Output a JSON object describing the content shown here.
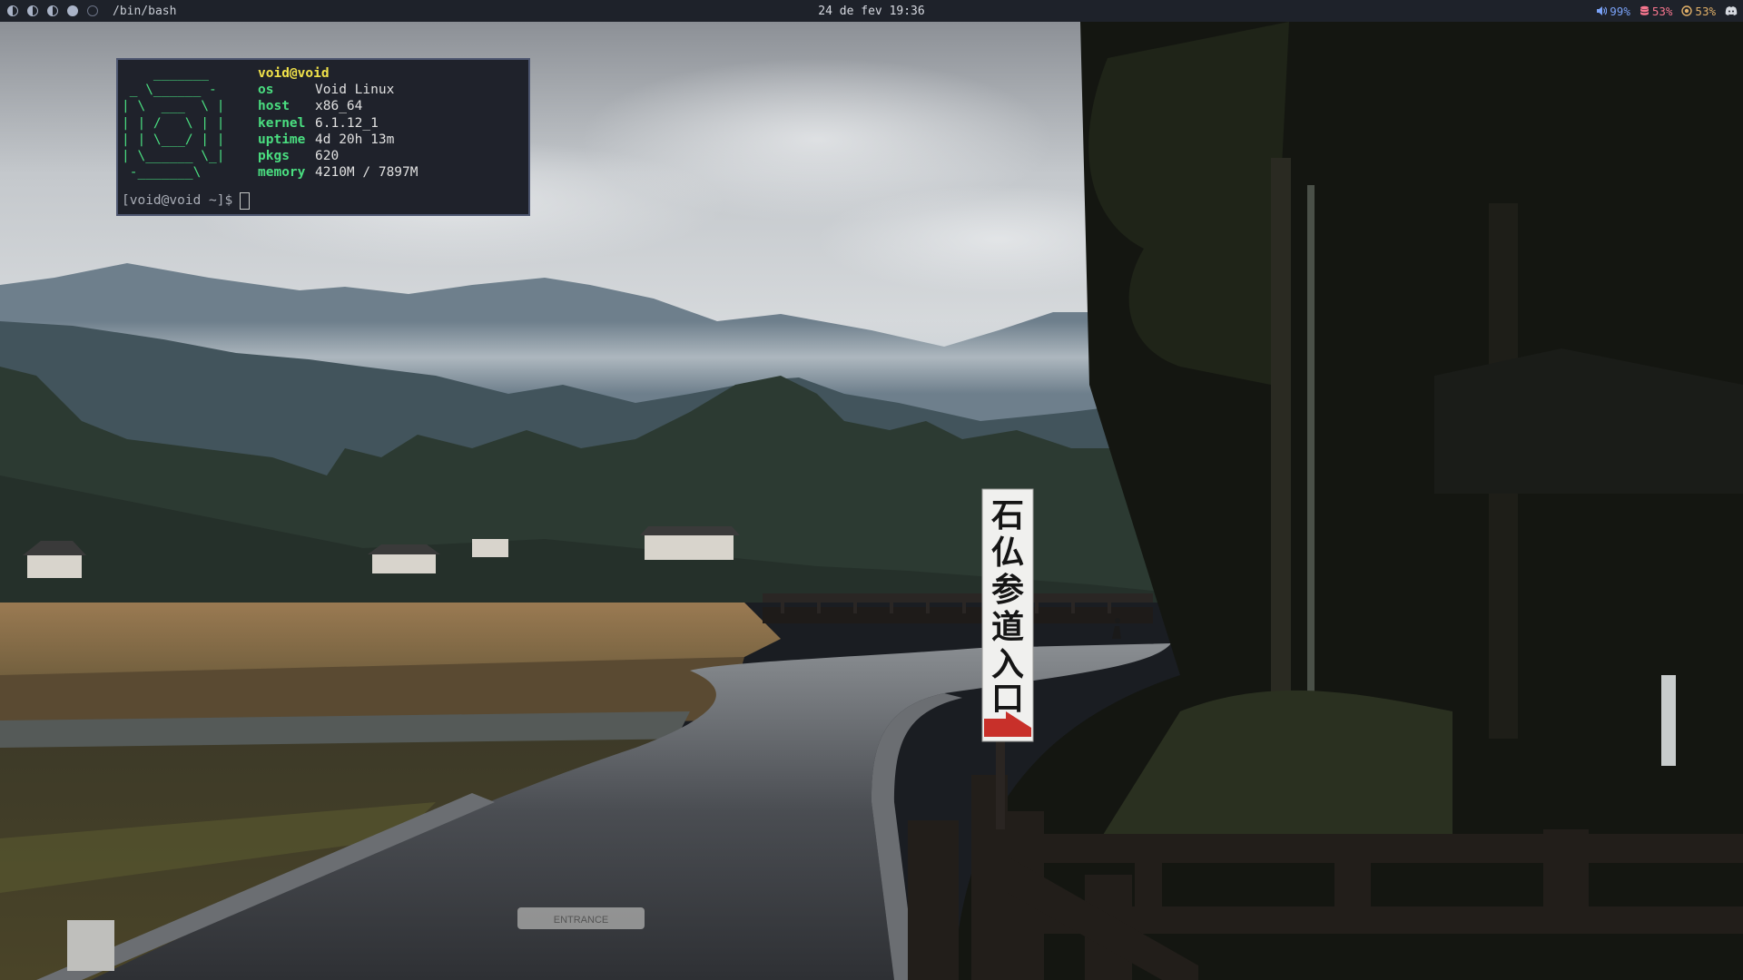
{
  "topbar": {
    "workspaces": [
      "half",
      "half",
      "half",
      "full",
      "empty"
    ],
    "window_title": "/bin/bash",
    "clock": "24 de fev 19:36",
    "status": {
      "volume": "99%",
      "disk": "53%",
      "cpu": "53%",
      "volume_color": "#7aa2f7",
      "disk_color": "#f7768e",
      "cpu_color": "#e0af68"
    }
  },
  "terminal": {
    "ascii_logo": "    _______\n _ \\______ -\n| \\  ___  \\ |\n| | /   \\ | |\n| | \\___/ | |\n| \\______ \\_|\n -_______\\",
    "user_host": "void@void",
    "fields": [
      {
        "key": "os",
        "value": "Void Linux"
      },
      {
        "key": "host",
        "value": "x86_64"
      },
      {
        "key": "kernel",
        "value": "6.1.12_1"
      },
      {
        "key": "uptime",
        "value": "4d 20h 13m"
      },
      {
        "key": "pkgs",
        "value": "620"
      },
      {
        "key": "memory",
        "value": "4210M / 7897M"
      }
    ],
    "prompt": "[void@void ~]$"
  },
  "wallpaper": {
    "sign_text": "石仏参道入口",
    "road_marking": "ENTRANCE"
  }
}
